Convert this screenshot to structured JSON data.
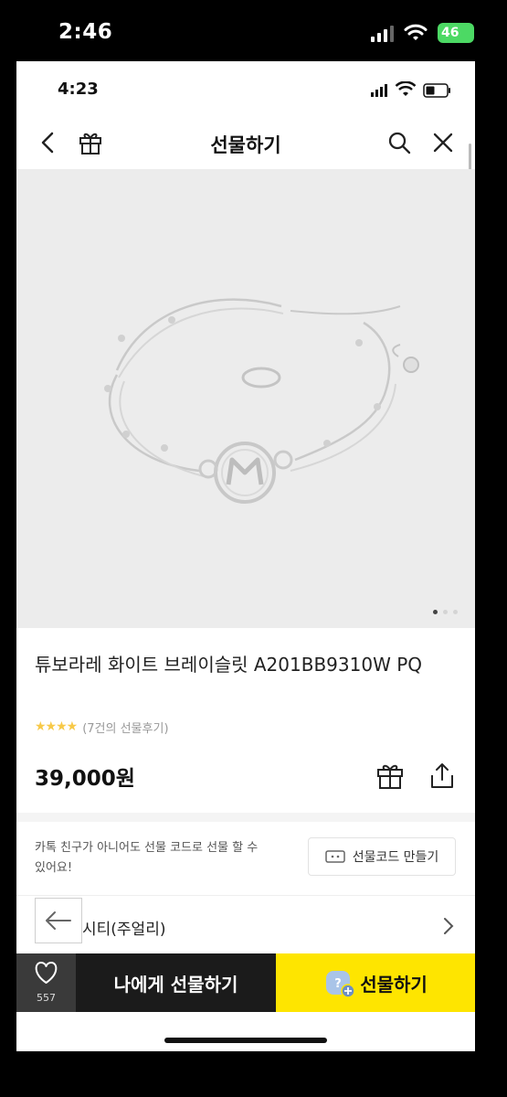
{
  "outer_status": {
    "time": "2:46",
    "battery": "46"
  },
  "inner_status": {
    "time": "4:23"
  },
  "nav": {
    "title": "선물하기"
  },
  "product": {
    "name": "튜보라레 화이트 브레이슬릿 A201BB9310W PQ",
    "stars": "★★★★",
    "reviews": "(7건의 선물후기)",
    "price": "39,000원",
    "image_dots": 3,
    "active_dot": 0
  },
  "gift_code": {
    "note": "카톡 친구가 아니어도 선물 코드로 선물 할 수 있어요!",
    "button": "선물코드 만들기"
  },
  "brand": {
    "name": "시티(주얼리)"
  },
  "bottom_bar": {
    "like_count": "557",
    "self_gift": "나에게 선물하기",
    "gift": "선물하기"
  },
  "colors": {
    "kakao_yellow": "#fee500",
    "dark_button": "#1b1b1b",
    "star": "#f7c948",
    "battery_green": "#4cd964"
  }
}
